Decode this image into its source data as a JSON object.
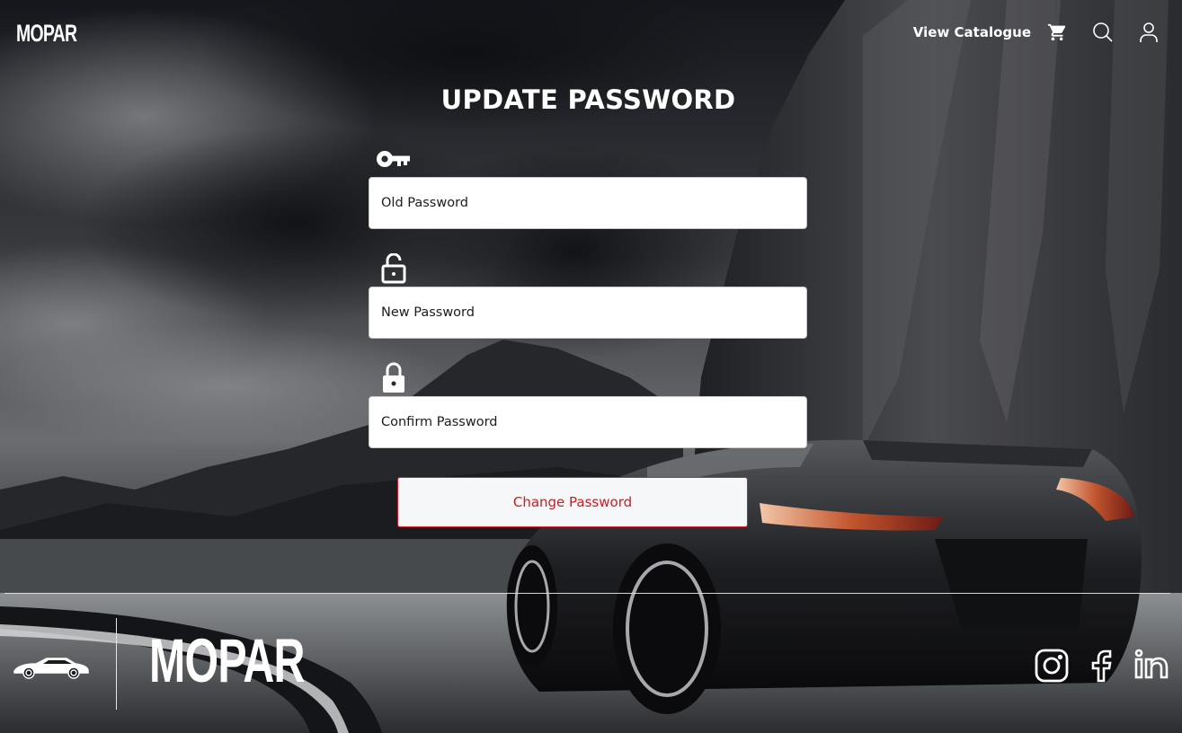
{
  "header": {
    "logo": "MOPAR",
    "nav_link": "View Catalogue",
    "icons": [
      "cart-icon",
      "search-icon",
      "user-icon"
    ]
  },
  "form": {
    "title": "UPDATE PASSWORD",
    "fields": [
      {
        "icon": "key-icon",
        "placeholder": "Old Password",
        "value": ""
      },
      {
        "icon": "unlocked-padlock-icon",
        "placeholder": "New Password",
        "value": ""
      },
      {
        "icon": "locked-padlock-icon",
        "placeholder": "Confirm Password",
        "value": ""
      }
    ],
    "submit_label": "Change Password"
  },
  "footer": {
    "logo": "MOPAR",
    "car_icon": "car-icon",
    "social": [
      "instagram-icon",
      "facebook-icon",
      "linkedin-icon"
    ]
  },
  "colors": {
    "accent": "#c81d25",
    "field_bg": "#ffffff",
    "button_bg": "#f6f7f9"
  }
}
